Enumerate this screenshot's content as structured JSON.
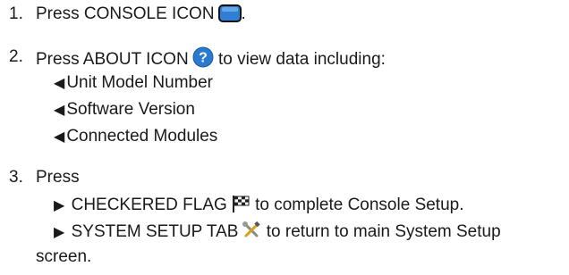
{
  "steps": [
    {
      "number": "1.",
      "text": "Press CONSOLE ICON",
      "suffix": ".",
      "icon": "console-icon"
    },
    {
      "number": "2.",
      "text": "Press ABOUT ICON",
      "suffix": "to view data including:",
      "icon": "about-question-icon",
      "subitems": [
        {
          "marker": "◀",
          "text": "Unit Model Number"
        },
        {
          "marker": "◀",
          "text": "Software Version"
        },
        {
          "marker": "◀",
          "text": "Connected Modules"
        }
      ]
    },
    {
      "number": "3.",
      "text": "Press",
      "subitems": [
        {
          "marker": "▶",
          "pre": "CHECKERED FLAG",
          "post": "to complete Console Setup.",
          "icon": "checkered-flag-icon"
        },
        {
          "marker": "▶",
          "pre": "SYSTEM SETUP TAB",
          "post": "to return to main System Setup",
          "icon": "system-setup-wrench-icon",
          "continuation": "screen."
        }
      ]
    }
  ],
  "colors": {
    "text": "#1a1a1a",
    "console_icon": "#2f7fd6",
    "about_icon": "#2a7bd0"
  }
}
